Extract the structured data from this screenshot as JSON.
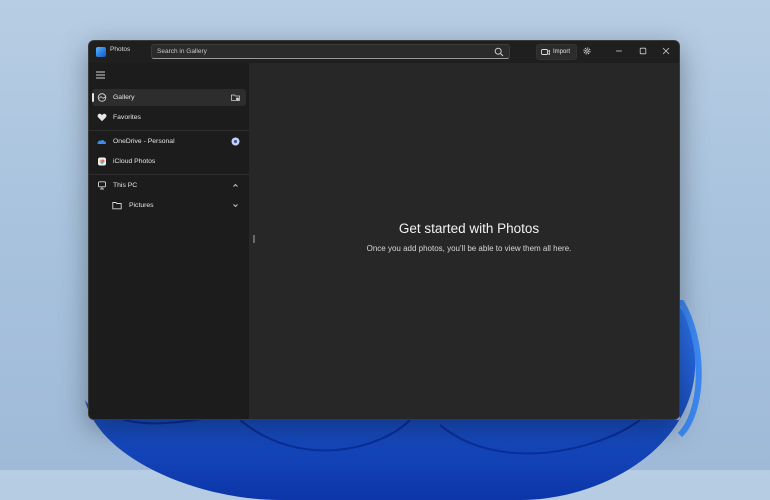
{
  "window": {
    "title": "Photos"
  },
  "search": {
    "placeholder": "Search in Gallery",
    "value": ""
  },
  "toolbar": {
    "import_label": "Import"
  },
  "sidebar": {
    "items": [
      {
        "label": "Gallery",
        "icon": "gallery-icon",
        "selected": true,
        "trailing_icon": "add-folder-icon"
      },
      {
        "label": "Favorites",
        "icon": "heart-icon"
      },
      {
        "label": "OneDrive - Personal",
        "icon": "onedrive-cloud-icon",
        "trailing_icon": "status-dot-icon"
      },
      {
        "label": "iCloud Photos",
        "icon": "icloud-icon"
      },
      {
        "label": "This PC",
        "icon": "computer-icon",
        "trailing_icon": "chevron-up-icon"
      },
      {
        "label": "Pictures",
        "icon": "folder-icon",
        "trailing_icon": "chevron-down-icon"
      }
    ]
  },
  "main": {
    "empty_title": "Get started with Photos",
    "empty_subtitle": "Once you add photos, you'll be able to view them all here."
  },
  "colors": {
    "window_bg": "#202020",
    "sidebar_bg": "#1c1c1c",
    "main_bg": "#272727",
    "accent": "#2d7fe0",
    "wallpaper": "#a9c3de",
    "bloom": "#1f5fe0"
  }
}
